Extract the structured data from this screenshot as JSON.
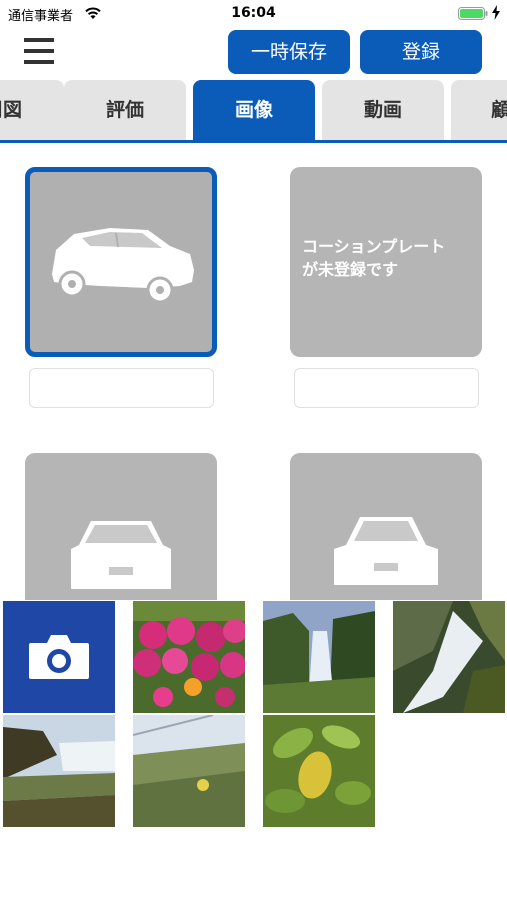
{
  "status_bar": {
    "carrier": "通信事業者",
    "time": "16:04"
  },
  "header": {
    "menu_icon": "hamburger-menu-icon",
    "temp_save_label": "一時保存",
    "register_label": "登録"
  },
  "tabs": [
    {
      "label": "周図"
    },
    {
      "label": "評価"
    },
    {
      "label": "画像",
      "active": true
    },
    {
      "label": "動画"
    },
    {
      "label": "顧"
    }
  ],
  "slots": {
    "no_plate_message_line1": "コーションプレート",
    "no_plate_message_line2": "が未登録です"
  },
  "picker": {
    "camera_icon": "camera-icon"
  },
  "colors": {
    "accent": "#0a5cb8",
    "camera_tile": "#1f47a6",
    "placeholder_gray": "#b5b5b5"
  }
}
